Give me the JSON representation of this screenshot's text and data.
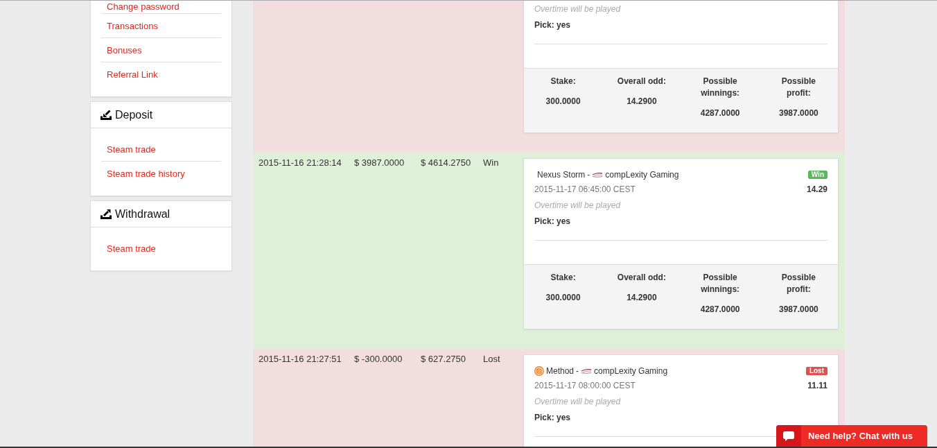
{
  "sidebar": {
    "panels": [
      {
        "kind": "links",
        "items": [
          {
            "label": "Change password"
          },
          {
            "label": "Transactions"
          },
          {
            "label": "Bonuses"
          },
          {
            "label": "Referral Link"
          }
        ]
      },
      {
        "kind": "deposit",
        "title": "Deposit",
        "items": [
          {
            "label": "Steam trade"
          },
          {
            "label": "Steam trade history"
          }
        ]
      },
      {
        "kind": "withdrawal",
        "title": "Withdrawal",
        "items": [
          {
            "label": "Steam trade"
          }
        ]
      }
    ]
  },
  "bets": [
    {
      "kind": "lost",
      "card": {
        "note": "Overtime will be played",
        "pick": "Pick: yes",
        "summary": [
          {
            "label": "Stake:",
            "value": "300.0000"
          },
          {
            "label": "Overall odd:",
            "value": "14.2900"
          },
          {
            "label": "Possible winnings:",
            "value": "4287.0000"
          },
          {
            "label": "Possible profit:",
            "value": "3987.0000"
          }
        ]
      }
    },
    {
      "kind": "win",
      "date": "2015-11-16 21:28:14",
      "amount": "$ 3987.0000",
      "balance": "$ 4614.2750",
      "status": "Win",
      "card": {
        "teams": [
          {
            "name": "Nexus Storm",
            "kind": "no-logo"
          },
          {
            "name": "compLexity Gaming",
            "kind": "swoosh-logo"
          }
        ],
        "separator": "-",
        "badge": "Win",
        "kickoff": "2015-11-17 06:45:00 CEST",
        "odds": "14.29",
        "note": "Overtime will be played",
        "pick": "Pick: yes",
        "summary": [
          {
            "label": "Stake:",
            "value": "300.0000"
          },
          {
            "label": "Overall odd:",
            "value": "14.2900"
          },
          {
            "label": "Possible winnings:",
            "value": "4287.0000"
          },
          {
            "label": "Possible profit:",
            "value": "3987.0000"
          }
        ]
      }
    },
    {
      "kind": "lost",
      "date": "2015-11-16 21:27:51",
      "amount": "$ -300.0000",
      "balance": "$ 627.2750",
      "status": "Lost",
      "card": {
        "teams": [
          {
            "name": "Method",
            "kind": "disc-logo"
          },
          {
            "name": "compLexity Gaming",
            "kind": "swoosh-logo"
          }
        ],
        "separator": "-",
        "badge": "Lost",
        "kickoff": "2015-11-17 08:00:00 CEST",
        "odds": "11.11",
        "note": "Overtime will be played",
        "pick": "Pick: yes"
      }
    }
  ],
  "chat": {
    "label": "Need help? Chat with us"
  }
}
